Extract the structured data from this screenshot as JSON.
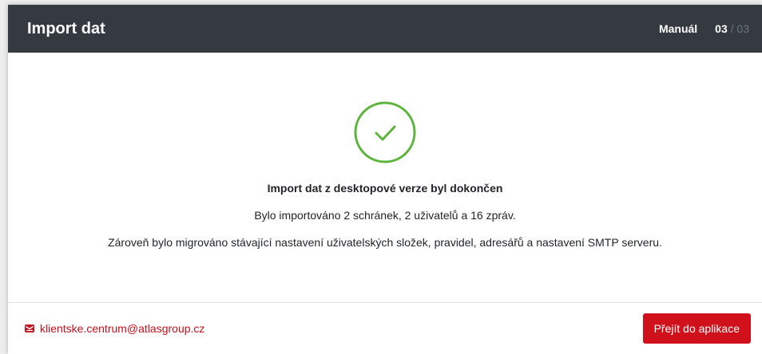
{
  "modal": {
    "title": "Import dat",
    "manual_label": "Manuál",
    "step_current": "03",
    "step_separator": "/",
    "step_total": "03"
  },
  "body": {
    "icon": "check-circle-icon",
    "headline": "Import dat z desktopové verze byl dokončen",
    "summary": "Bylo importováno 2 schránek, 2 uživatelů a 16 zpráv.",
    "migration_note": "Zároveň bylo migrováno stávající nastavení uživatelských složek, pravidel, adresářů a nastavení SMTP serveru."
  },
  "footer": {
    "contact_icon": "mail-icon",
    "contact_email": "klientske.centrum@atlasgroup.cz",
    "primary_button_label": "Přejít do aplikace"
  },
  "colors": {
    "header_bg": "#343a40",
    "success_green": "#5db43c",
    "brand_red": "#d0111b",
    "link_red": "#c4101c"
  }
}
